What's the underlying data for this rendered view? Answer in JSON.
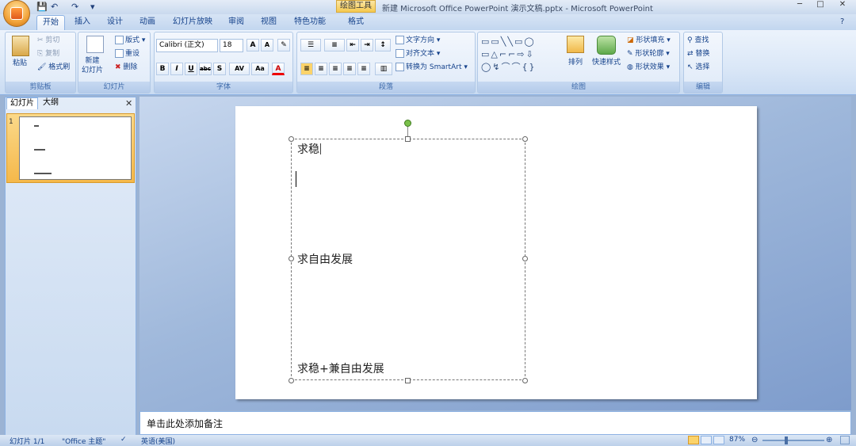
{
  "window": {
    "title": "新建 Microsoft Office PowerPoint 演示文稿.pptx - Microsoft PowerPoint",
    "context_tab": "绘图工具"
  },
  "tabs": [
    "开始",
    "插入",
    "设计",
    "动画",
    "幻灯片放映",
    "审阅",
    "视图",
    "特色功能",
    "格式"
  ],
  "ribbon": {
    "clipboard": {
      "label": "剪贴板",
      "paste": "粘贴",
      "cut": "剪切",
      "copy": "复制",
      "format_painter": "格式刷"
    },
    "slides": {
      "label": "幻灯片",
      "new_slide": "新建\n幻灯片",
      "layout": "版式",
      "reset": "重设",
      "delete": "删除"
    },
    "font": {
      "label": "字体",
      "font_name": "Calibri (正文)",
      "font_size": "18"
    },
    "paragraph": {
      "label": "段落",
      "text_direction": "文字方向",
      "align_text": "对齐文本",
      "smartart": "转换为 SmartArt"
    },
    "drawing": {
      "label": "绘图",
      "arrange": "排列",
      "quick_styles": "快速样式",
      "shape_fill": "形状填充",
      "shape_outline": "形状轮廓",
      "shape_effects": "形状效果"
    },
    "editing": {
      "label": "编辑",
      "find": "查找",
      "replace": "替换",
      "select": "选择"
    }
  },
  "left_pane": {
    "tab_slides": "幻灯片",
    "tab_outline": "大纲",
    "slide_number": "1"
  },
  "slide": {
    "line1": "求稳",
    "line2": "求自由发展",
    "line3": "求稳+兼自由发展"
  },
  "notes_placeholder": "单击此处添加备注",
  "status": {
    "slide_info": "幻灯片 1/1",
    "theme": "\"Office 主题\"",
    "language": "英语(美国)",
    "zoom": "87%"
  }
}
